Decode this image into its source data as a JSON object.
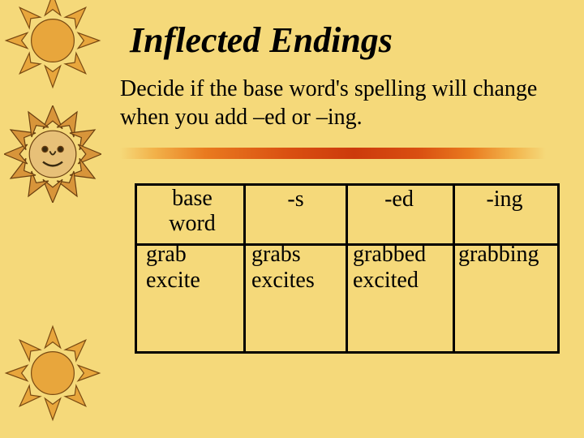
{
  "title": "Inflected Endings",
  "subtitle": "Decide if the base word's spelling will change when you add –ed or –ing.",
  "table": {
    "headers": {
      "col1_line1": "base",
      "col1_line2": "word",
      "col2": "-s",
      "col3": "-ed",
      "col4": "-ing"
    },
    "rows": [
      {
        "base": "grab",
        "s": "grabs",
        "ed": "grabbed",
        "ing": "grabbing"
      },
      {
        "base": "excite",
        "s": "excites",
        "ed": "excited",
        "ing": ""
      }
    ]
  },
  "icons": {
    "sun_top": "sun-icon",
    "sun_face": "sun-face-icon",
    "sun_bottom": "sun-icon"
  }
}
